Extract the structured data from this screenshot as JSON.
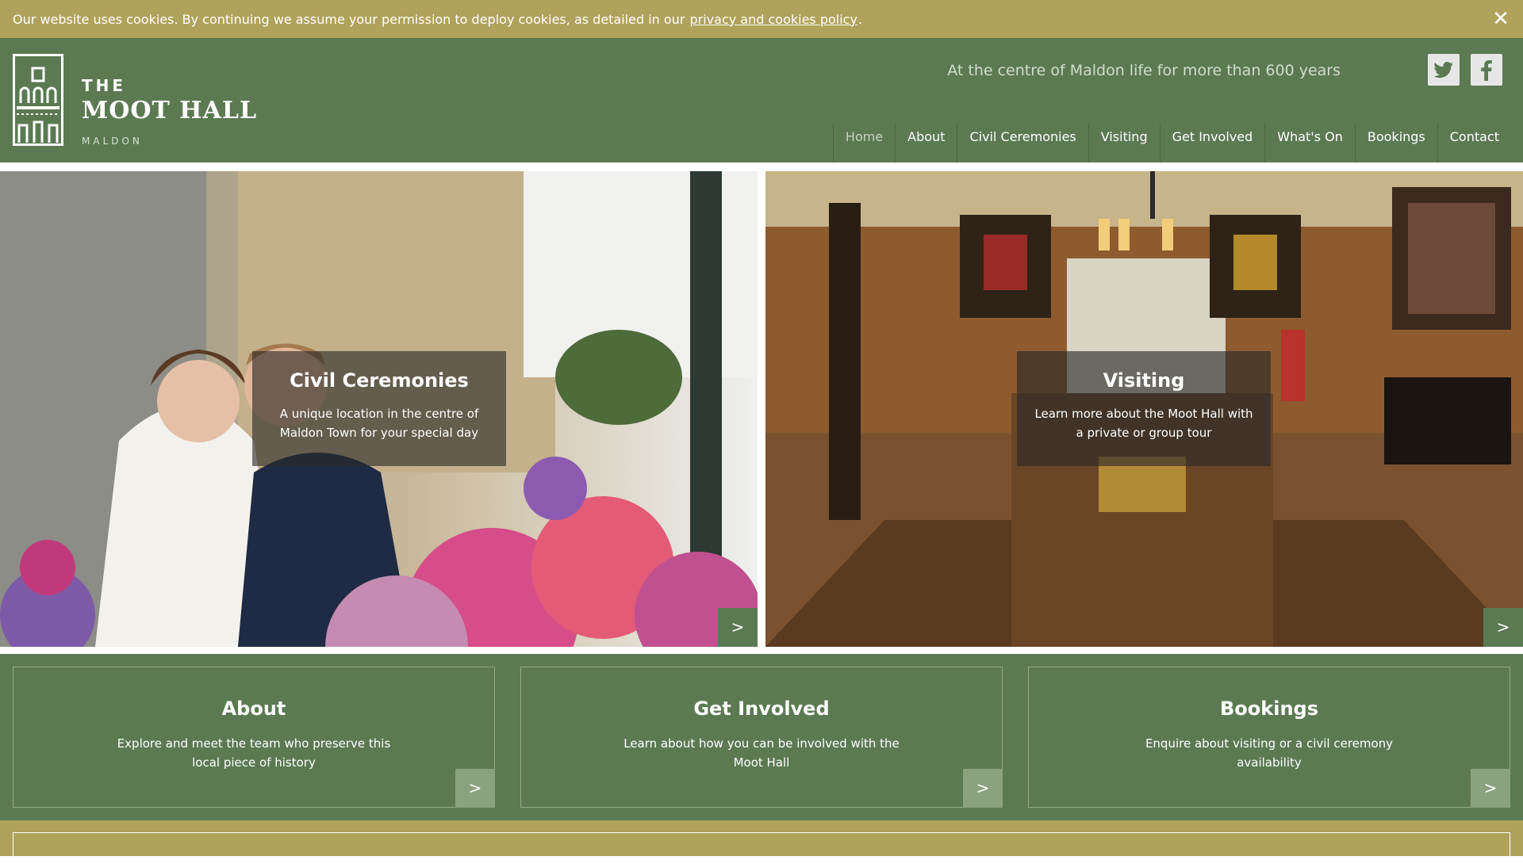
{
  "cookie": {
    "text_before": "Our website uses cookies. By continuing we assume your permission to deploy cookies, as detailed in our",
    "link": "privacy and cookies policy",
    "text_after": ".",
    "close_glyph": "✕"
  },
  "header": {
    "logo": {
      "the": "THE",
      "name": "MOOT HALL",
      "sub": "MALDON"
    },
    "tagline": "At the centre of Maldon life for more than 600 years",
    "social": [
      "twitter-icon",
      "facebook-icon"
    ]
  },
  "nav": {
    "items": [
      {
        "label": "Home",
        "active": true
      },
      {
        "label": "About"
      },
      {
        "label": "Civil Ceremonies"
      },
      {
        "label": "Visiting"
      },
      {
        "label": "Get Involved"
      },
      {
        "label": "What's On"
      },
      {
        "label": "Bookings"
      },
      {
        "label": "Contact"
      }
    ]
  },
  "hero": [
    {
      "title": "Civil Ceremonies",
      "text": "A unique location in the centre of Maldon Town for your special day",
      "arrow": ">"
    },
    {
      "title": "Visiting",
      "text": "Learn more about the Moot Hall with a private or group tour",
      "arrow": ">"
    }
  ],
  "cards": [
    {
      "title": "About",
      "text": "Explore and meet the team who preserve this local piece of history",
      "arrow": ">"
    },
    {
      "title": "Get Involved",
      "text": "Learn about how you can be involved with the Moot Hall",
      "arrow": ">"
    },
    {
      "title": "Bookings",
      "text": "Enquire about visiting or a civil ceremony availability",
      "arrow": ">"
    }
  ],
  "colors": {
    "brand_green": "#5b7a52",
    "cookie_gold": "#b0a25a",
    "card_button": "#8ba27e"
  }
}
